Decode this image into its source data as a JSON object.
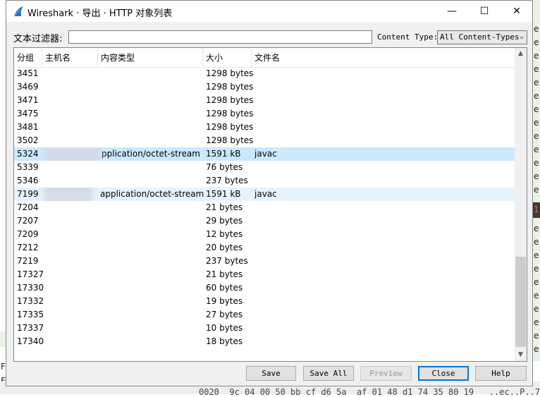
{
  "background": {
    "right_glyphs": [
      "e",
      "e",
      "e",
      "e",
      "e",
      "e",
      "e",
      "e",
      "e",
      "e",
      "e",
      "e",
      "e",
      "e",
      "e",
      "e",
      "e",
      "e",
      "e",
      "e",
      "e",
      "e",
      "e",
      "e"
    ],
    "right_dark_glyph": "1",
    "bottom_left1": "F",
    "bottom_left2": "E",
    "bottom_hex": "0020  9c 04 00 50 bb cf d6 5a  af 01 48 d1 74 35 80 19   ..ec..P..7"
  },
  "window": {
    "title": "Wireshark · 导出 · HTTP 对象列表",
    "minimize": "—",
    "maximize": "☐",
    "close": "✕"
  },
  "filter": {
    "label": "文本过滤器:",
    "value": "",
    "content_type_label": "Content Type:",
    "content_type_value": "All Content-Types"
  },
  "table": {
    "headers": [
      "分组",
      "主机名",
      "内容类型",
      "大小",
      "文件名"
    ],
    "rows": [
      {
        "packet": "3451",
        "host": "",
        "type": "",
        "size": "1298 bytes",
        "file": ""
      },
      {
        "packet": "3469",
        "host": "",
        "type": "",
        "size": "1298 bytes",
        "file": ""
      },
      {
        "packet": "3471",
        "host": "",
        "type": "",
        "size": "1298 bytes",
        "file": ""
      },
      {
        "packet": "3475",
        "host": "",
        "type": "",
        "size": "1298 bytes",
        "file": ""
      },
      {
        "packet": "3481",
        "host": "",
        "type": "",
        "size": "1298 bytes",
        "file": ""
      },
      {
        "packet": "3502",
        "host": "",
        "type": "",
        "size": "1298 bytes",
        "file": ""
      },
      {
        "packet": "5324",
        "host": "",
        "type": "pplication/octet-stream",
        "size": "1591 kB",
        "file": "javac"
      },
      {
        "packet": "5339",
        "host": "",
        "type": "",
        "size": "76 bytes",
        "file": ""
      },
      {
        "packet": "5346",
        "host": "",
        "type": "",
        "size": "237 bytes",
        "file": ""
      },
      {
        "packet": "7199",
        "host": "",
        "type": "application/octet-stream",
        "size": "1591 kB",
        "file": "javac"
      },
      {
        "packet": "7204",
        "host": "",
        "type": "",
        "size": "21 bytes",
        "file": ""
      },
      {
        "packet": "7207",
        "host": "",
        "type": "",
        "size": "29 bytes",
        "file": ""
      },
      {
        "packet": "7209",
        "host": "",
        "type": "",
        "size": "12 bytes",
        "file": ""
      },
      {
        "packet": "7212",
        "host": "",
        "type": "",
        "size": "20 bytes",
        "file": ""
      },
      {
        "packet": "7219",
        "host": "",
        "type": "",
        "size": "237 bytes",
        "file": ""
      },
      {
        "packet": "17327",
        "host": "",
        "type": "",
        "size": "21 bytes",
        "file": ""
      },
      {
        "packet": "17330",
        "host": "",
        "type": "",
        "size": "60 bytes",
        "file": ""
      },
      {
        "packet": "17332",
        "host": "",
        "type": "",
        "size": "19 bytes",
        "file": ""
      },
      {
        "packet": "17335",
        "host": "",
        "type": "",
        "size": "27 bytes",
        "file": ""
      },
      {
        "packet": "17337",
        "host": "",
        "type": "",
        "size": "10 bytes",
        "file": ""
      },
      {
        "packet": "17340",
        "host": "",
        "type": "",
        "size": "18 bytes",
        "file": ""
      }
    ]
  },
  "buttons": {
    "save": "Save",
    "save_all": "Save All",
    "preview": "Preview",
    "close": "Close",
    "help": "Help"
  },
  "colors": {
    "selected_row": "#cce8ff",
    "hover_row": "#e5f3ff",
    "accent": "#0078d7"
  }
}
